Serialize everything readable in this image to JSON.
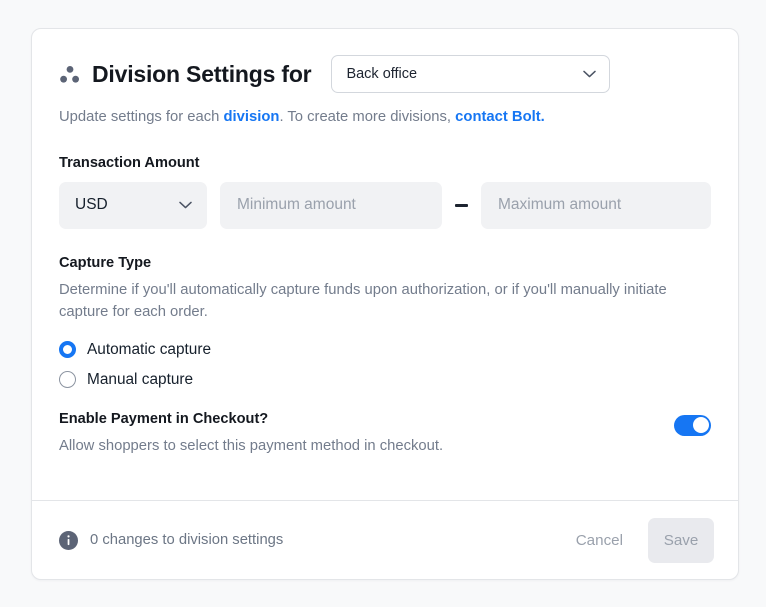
{
  "header": {
    "icon": "division-dots-icon",
    "title": "Division Settings for",
    "division_select": {
      "value": "Back office",
      "chevron": "chevron-down-icon"
    },
    "subtitle": {
      "part1": "Update settings for each ",
      "link1": "division",
      "part2": ". To create more divisions, ",
      "link2": "contact Bolt.",
      "link_color": "#1676f3"
    }
  },
  "transaction_amount": {
    "label": "Transaction Amount",
    "currency": {
      "value": "USD",
      "chevron": "chevron-down-icon"
    },
    "min_input": {
      "value": "",
      "placeholder": "Minimum amount"
    },
    "separator": "—",
    "max_input": {
      "value": "",
      "placeholder": "Maximum amount"
    }
  },
  "capture_type": {
    "label": "Capture Type",
    "description": "Determine if you'll automatically capture funds upon authorization, or if you'll manually initiate capture for each order.",
    "options": [
      {
        "label": "Automatic capture",
        "selected": true
      },
      {
        "label": "Manual capture",
        "selected": false
      }
    ],
    "selected_color": "#1676f3"
  },
  "enable_payment": {
    "label": "Enable Payment in Checkout?",
    "description": "Allow shoppers to select this payment method in checkout.",
    "toggle_on": true,
    "toggle_color": "#1676f3"
  },
  "footer": {
    "info_icon": "info-icon",
    "changes_text": "0 changes to division settings",
    "cancel_label": "Cancel",
    "save_label": "Save",
    "save_disabled": true
  }
}
